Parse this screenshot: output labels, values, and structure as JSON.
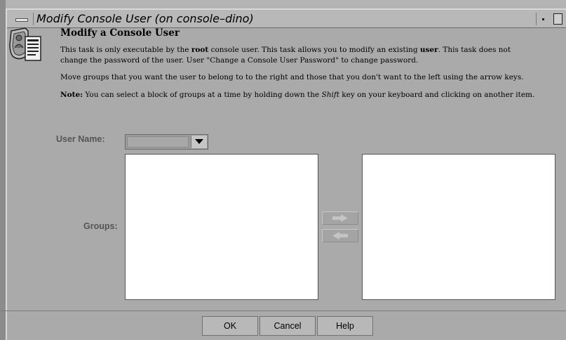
{
  "window": {
    "title": "Modify Console User (on console–dino)"
  },
  "task": {
    "icon": "user-shield-document-icon",
    "heading": "Modify a Console User",
    "desc_line1_pre": "This task is only executable by the ",
    "desc_line1_bold1": "root",
    "desc_line1_mid": " console user. This task allows you to modify an existing ",
    "desc_line1_bold2": "user",
    "desc_line1_post": ". This task does not",
    "desc_line2": "change the password of the user. User \"Change a Console User Password\" to change password.",
    "desc_line3": "Move groups that you want the user to belong to to the right and those that you don't want to the left using the arrow keys.",
    "note_label": "Note:",
    "note_pre": "  You can select a block of groups at a time by holding down the ",
    "note_key": "Shift",
    "note_post": " key on your keyboard and clicking on another item."
  },
  "form": {
    "user_name_label": "User Name:",
    "user_name_value": "",
    "groups_label": "Groups:",
    "available_groups": [],
    "selected_groups": []
  },
  "buttons": {
    "ok": "OK",
    "cancel": "Cancel",
    "help": "Help"
  }
}
